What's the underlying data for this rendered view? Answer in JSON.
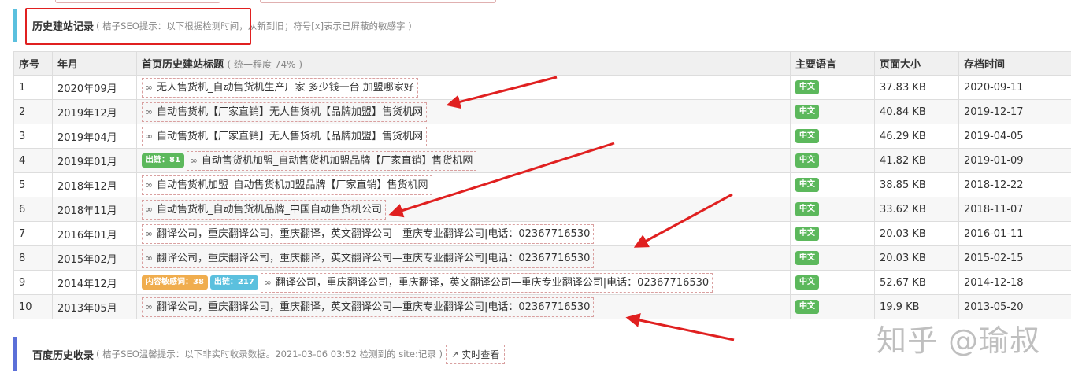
{
  "section1": {
    "title": "历史建站记录",
    "hint": "( 桔子SEO提示：以下根据检测时间，从新到旧；符号[x]表示已屏蔽的敏感字 )"
  },
  "table": {
    "headers": {
      "index": "序号",
      "month": "年月",
      "title": "首页历史建站标题",
      "title_sub": "( 统一程度 74% )",
      "lang": "主要语言",
      "size": "页面大小",
      "archive": "存档时间"
    },
    "rows": [
      {
        "index": "1",
        "month": "2020年09月",
        "badges": [],
        "title": "无人售货机_自动售货机生产厂家 多少钱一台 加盟哪家好",
        "lang": "中文",
        "size": "37.83 KB",
        "archive": "2020-09-11"
      },
      {
        "index": "2",
        "month": "2019年12月",
        "badges": [],
        "title": "自动售货机【厂家直销】无人售货机【品牌加盟】售货机网",
        "lang": "中文",
        "size": "40.84 KB",
        "archive": "2019-12-17"
      },
      {
        "index": "3",
        "month": "2019年04月",
        "badges": [],
        "title": "自动售货机【厂家直销】无人售货机【品牌加盟】售货机网",
        "lang": "中文",
        "size": "46.29 KB",
        "archive": "2019-04-05"
      },
      {
        "index": "4",
        "month": "2019年01月",
        "badges": [
          {
            "text": "出链：81",
            "color": "green"
          }
        ],
        "title": "自动售货机加盟_自动售货机加盟品牌【厂家直销】售货机网",
        "lang": "中文",
        "size": "41.82 KB",
        "archive": "2019-01-09"
      },
      {
        "index": "5",
        "month": "2018年12月",
        "badges": [],
        "title": "自动售货机加盟_自动售货机加盟品牌【厂家直销】售货机网",
        "lang": "中文",
        "size": "38.85 KB",
        "archive": "2018-12-22"
      },
      {
        "index": "6",
        "month": "2018年11月",
        "badges": [],
        "title": "自动售货机_自动售货机品牌_中国自动售货机公司",
        "lang": "中文",
        "size": "33.62 KB",
        "archive": "2018-11-07"
      },
      {
        "index": "7",
        "month": "2016年01月",
        "badges": [],
        "title": "翻译公司，重庆翻译公司，重庆翻译，英文翻译公司—重庆专业翻译公司|电话：02367716530",
        "lang": "中文",
        "size": "20.03 KB",
        "archive": "2016-01-11"
      },
      {
        "index": "8",
        "month": "2015年02月",
        "badges": [],
        "title": "翻译公司，重庆翻译公司，重庆翻译，英文翻译公司—重庆专业翻译公司|电话：02367716530",
        "lang": "中文",
        "size": "20.03 KB",
        "archive": "2015-02-15"
      },
      {
        "index": "9",
        "month": "2014年12月",
        "badges": [
          {
            "text": "内容敏感词：38",
            "color": "orange"
          },
          {
            "text": "出链：217",
            "color": "blue"
          }
        ],
        "title": "翻译公司，重庆翻译公司，重庆翻译，英文翻译公司—重庆专业翻译公司|电话：02367716530",
        "lang": "中文",
        "size": "52.67 KB",
        "archive": "2014-12-18"
      },
      {
        "index": "10",
        "month": "2013年05月",
        "badges": [],
        "title": "翻译公司，重庆翻译公司，重庆翻译，英文翻译公司—重庆专业翻译公司|电话：02367716530",
        "lang": "中文",
        "size": "19.9 KB",
        "archive": "2013-05-20"
      }
    ]
  },
  "section2": {
    "title": "百度历史收录",
    "hint": "( 桔子SEO温馨提示：以下非实时收录数据。2021-03-06 03:52 检测到的 site:记录 )",
    "button_label": "实时查看"
  },
  "watermark": "知乎 @瑜叔",
  "colors": {
    "accent_blue": "#5bc0de",
    "accent_indigo": "#5b6fd8",
    "badge_green": "#5cb85c",
    "badge_orange": "#f0ad4e",
    "annotation_red": "#e02020"
  }
}
